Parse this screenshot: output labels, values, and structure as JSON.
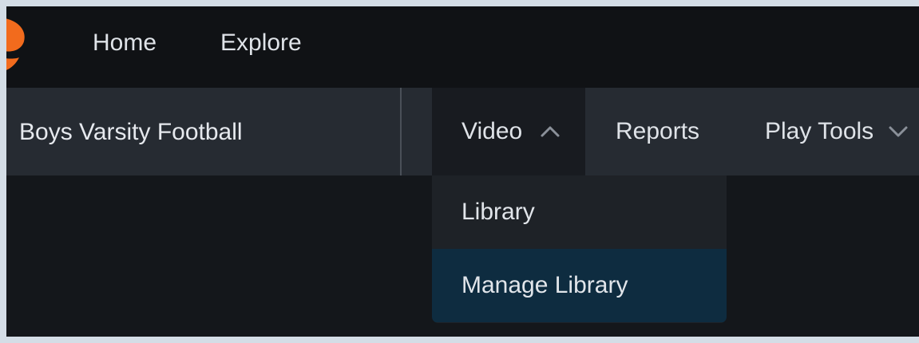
{
  "topnav": {
    "items": [
      {
        "label": "Home"
      },
      {
        "label": "Explore"
      }
    ]
  },
  "team": {
    "name": "Boys Varsity Football"
  },
  "tabs": [
    {
      "label": "Video",
      "state": "expanded",
      "icon": "chevron-up-icon"
    },
    {
      "label": "Reports"
    },
    {
      "label": "Play Tools",
      "icon": "chevron-down-icon"
    }
  ],
  "dropdown": {
    "items": [
      {
        "label": "Library"
      },
      {
        "label": "Manage Library",
        "state": "highlighted"
      }
    ]
  },
  "colors": {
    "brand": "#f26b1d",
    "topbar": "#101215",
    "subbar": "#262b32",
    "highlight": "#0e2c40"
  }
}
